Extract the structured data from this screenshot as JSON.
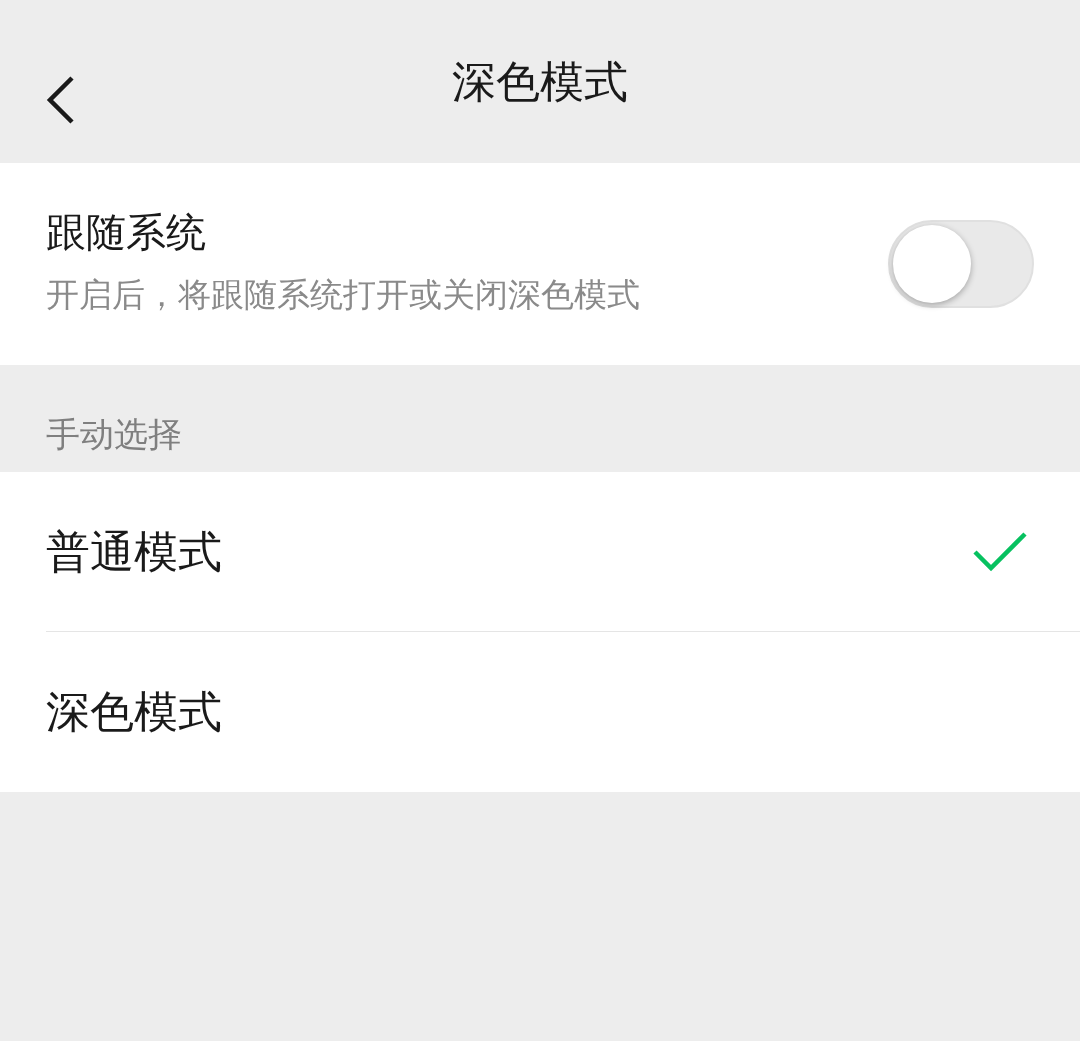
{
  "header": {
    "title": "深色模式"
  },
  "follow_system": {
    "title": "跟随系统",
    "description": "开启后，将跟随系统打开或关闭深色模式",
    "on": false
  },
  "section": {
    "label": "手动选择"
  },
  "options": [
    {
      "label": "普通模式",
      "selected": true
    },
    {
      "label": "深色模式",
      "selected": false
    }
  ]
}
